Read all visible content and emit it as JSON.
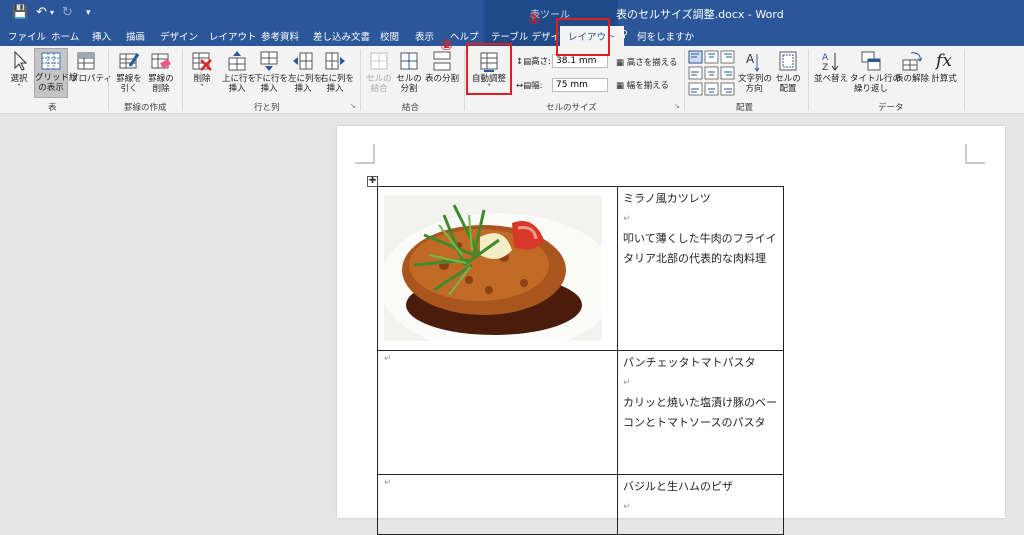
{
  "titlebar": {
    "context_tools": "表ツール",
    "document_title": "表のセルサイズ調整.docx  -  Word"
  },
  "tabs": [
    "ファイル",
    "ホーム",
    "挿入",
    "描画",
    "デザイン",
    "レイアウト",
    "参考資料",
    "差し込み文書",
    "校閲",
    "表示",
    "ヘルプ",
    "テーブル デザイン",
    "レイアウト",
    "何をしますか"
  ],
  "ribbon": {
    "select": "選択",
    "gridlines": [
      "グリッド線",
      "の表示"
    ],
    "properties": "プロパティ",
    "draw_borders": [
      "罫線を",
      "引く"
    ],
    "erase_borders": [
      "罫線の",
      "削除"
    ],
    "delete": "削除",
    "insert_above": [
      "上に行を",
      "挿入"
    ],
    "insert_below": [
      "下に行を",
      "挿入"
    ],
    "insert_left": [
      "左に列を",
      "挿入"
    ],
    "insert_right": [
      "右に列を",
      "挿入"
    ],
    "merge_cells": [
      "セルの",
      "結合"
    ],
    "split_cells": [
      "セルの",
      "分割"
    ],
    "split_table": "表の分割",
    "autofit": "自動調整",
    "height_label": "高さ:",
    "height_value": "38.1 mm",
    "width_label": "幅:",
    "width_value": "75 mm",
    "distribute_rows": "高さを揃える",
    "distribute_cols": "幅を揃える",
    "text_direction": [
      "文字列の",
      "方向"
    ],
    "cell_margins": [
      "セルの",
      "配置"
    ],
    "sort": "並べ替え",
    "repeat_header": [
      "タイトル行の",
      "繰り返し"
    ],
    "convert": "表の解除",
    "formula": "計算式",
    "formula_icon": "fx",
    "groups": [
      "表",
      "罫線の作成",
      "行と列",
      "結合",
      "セルのサイズ",
      "配置",
      "データ"
    ]
  },
  "annotations": {
    "one": "①",
    "two": "②"
  },
  "table": {
    "rows": [
      {
        "title": "ミラノ風カツレツ",
        "desc": "叩いて薄くした牛肉のフライイタリア北部の代表的な肉料理"
      },
      {
        "title": "パンチェッタトマトパスタ",
        "desc": "カリッと焼いた塩漬け豚のベーコンとトマトソースのパスタ"
      },
      {
        "title": "バジルと生ハムのピザ",
        "desc": ""
      }
    ],
    "mark": "↵"
  }
}
